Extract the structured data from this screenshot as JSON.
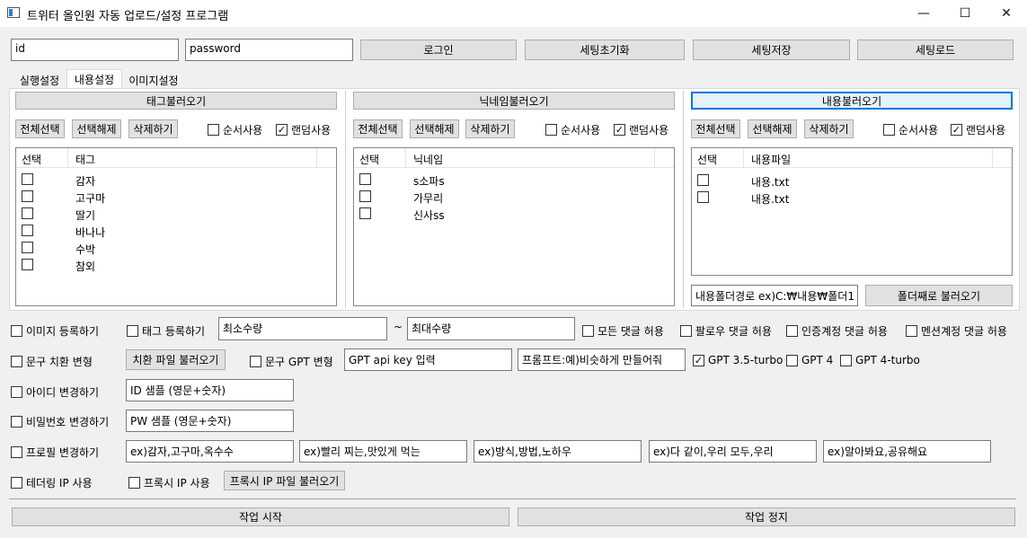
{
  "window": {
    "title": "트위터 올인원 자동 업로드/설정 프로그램",
    "minimize": "—",
    "maximize": "☐",
    "close": "✕"
  },
  "login": {
    "id_value": "id",
    "password_value": "password",
    "login_button": "로그인",
    "reset_settings_button": "세팅초기화",
    "save_settings_button": "세팅저장",
    "load_settings_button": "세팅로드"
  },
  "tabs": [
    "실행설정",
    "내용설정",
    "이미지설정"
  ],
  "panels": {
    "tag": {
      "load_button": "태그불러오기",
      "select_all": "전체선택",
      "deselect": "선택해제",
      "delete": "삭제하기",
      "sequential": "순서사용",
      "random": "랜덤사용",
      "sequential_checked": false,
      "random_checked": true,
      "col_select": "선택",
      "col_name": "태그",
      "rows": [
        "감자",
        "고구마",
        "딸기",
        "바나나",
        "수박",
        "참외"
      ]
    },
    "nickname": {
      "load_button": "닉네임불러오기",
      "select_all": "전체선택",
      "deselect": "선택해제",
      "delete": "삭제하기",
      "sequential": "순서사용",
      "random": "랜덤사용",
      "sequential_checked": false,
      "random_checked": true,
      "col_select": "선택",
      "col_name": "닉네임",
      "rows": [
        "s소파s",
        "가무리",
        "신사ss"
      ]
    },
    "content": {
      "load_button": "내용불러오기",
      "select_all": "전체선택",
      "deselect": "선택해제",
      "delete": "삭제하기",
      "sequential": "순서사용",
      "random": "랜덤사용",
      "sequential_checked": false,
      "random_checked": true,
      "col_select": "선택",
      "col_name": "내용파일",
      "rows": [
        "내용.txt",
        "내용.txt"
      ],
      "folder_path_value": "내용폴더경로 ex)C:₩내용₩폴더1",
      "load_folder_button": "폴더째로 불러오기"
    }
  },
  "options": {
    "image_register": "이미지 등록하기",
    "tag_register": "태그 등록하기",
    "min_count": "최소수량",
    "tilde": "~",
    "max_count": "최대수량",
    "allow_all_replies": "모든 댓글 허용",
    "follower_replies": "팔로우 댓글 허용",
    "verified_replies": "인증계정 댓글 허용",
    "mention_replies": "멘션계정 댓글 허용",
    "phrase_replace": "문구 치환 변형",
    "load_replace_file": "치환 파일 불러오기",
    "phrase_gpt": "문구 GPT 변형",
    "gpt_api_key": "GPT api key 입력",
    "prompt": "프롬프트:예)비슷하게 만들어줘",
    "gpt35": "GPT 3.5-turbo",
    "gpt35_checked": true,
    "gpt4": "GPT 4",
    "gpt4turbo": "GPT 4-turbo",
    "change_id": "아이디 변경하기",
    "id_sample": "ID 샘플 (영문+숫자)",
    "change_pw": "비밀번호 변경하기",
    "pw_sample": "PW 샘플 (영문+숫자)",
    "change_profile": "프로필 변경하기",
    "profile_fields": [
      "ex)감자,고구마,옥수수",
      "ex)빨리 찌는,맛있게 먹는",
      "ex)방식,방법,노하우",
      "ex)다 같이,우리 모두,우리",
      "ex)알아봐요,공유해요"
    ],
    "tethering_ip": "테더링 IP 사용",
    "proxy_ip": "프록시 IP 사용",
    "load_proxy_file": "프록시 IP 파일 불러오기"
  },
  "footer": {
    "start": "작업 시작",
    "stop": "작업 정지"
  }
}
